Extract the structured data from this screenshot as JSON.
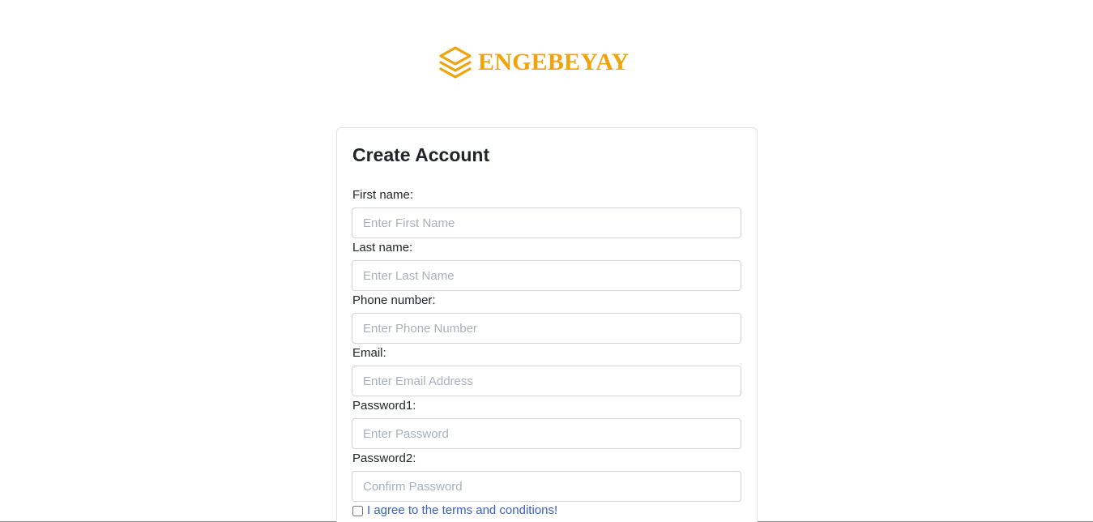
{
  "brand": {
    "logo_icon": "layers-icon",
    "name": "ENGEBEYAY",
    "color": "#f0a30a"
  },
  "form": {
    "title": "Create Account",
    "fields": [
      {
        "label": "First name:",
        "placeholder": "Enter First Name",
        "value": ""
      },
      {
        "label": "Last name:",
        "placeholder": "Enter Last Name",
        "value": ""
      },
      {
        "label": "Phone number:",
        "placeholder": "Enter Phone Number",
        "value": ""
      },
      {
        "label": "Email:",
        "placeholder": "Enter Email Address",
        "value": ""
      },
      {
        "label": "Password1:",
        "placeholder": "Enter Password",
        "value": ""
      },
      {
        "label": "Password2:",
        "placeholder": "Confirm Password",
        "value": ""
      }
    ],
    "terms": {
      "checked": false,
      "label": "I agree to the terms and conditions!",
      "link_color": "#3b5fc0"
    }
  }
}
